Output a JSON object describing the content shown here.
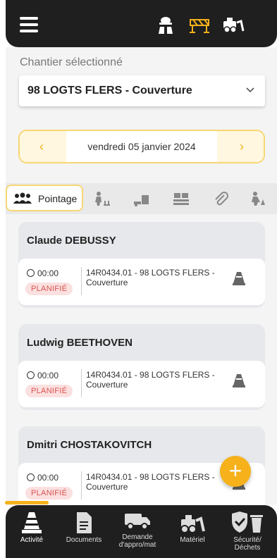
{
  "header": {
    "icons": [
      "worker-icon",
      "barrier-icon",
      "machinery-icon"
    ]
  },
  "site": {
    "label": "Chantier sélectionné",
    "selected": "98 LOGTS FLERS - Couverture"
  },
  "date": {
    "prev": "‹",
    "next": "›",
    "value": "vendredi 05 janvier 2024"
  },
  "tabs": {
    "active_label": "Pointage",
    "items": [
      "team-icon",
      "worker-move-icon",
      "delivery-icon",
      "pallet-icon",
      "paperclip-icon",
      "site-worker-icon"
    ]
  },
  "cards": [
    {
      "name": "Claude DEBUSSY",
      "time": "00:00",
      "status": "PLANIFIÉ",
      "description": "14R0434.01 - 98 LOGTS FLERS - Couverture"
    },
    {
      "name": "Ludwig BEETHOVEN",
      "time": "00:00",
      "status": "PLANIFIÉ",
      "description": "14R0434.01 - 98 LOGTS FLERS - Couverture"
    },
    {
      "name": "Dmitri CHOSTAKOVITCH",
      "time": "00:00",
      "status": "PLANIFIÉ",
      "description": "14R0434.01 - 98 LOGTS FLERS - Couverture"
    }
  ],
  "fab": {
    "label": "+"
  },
  "bottom_nav": [
    {
      "label": "Activité",
      "icon": "cone-icon",
      "active": true
    },
    {
      "label": "Documents",
      "icon": "document-icon"
    },
    {
      "label": "Demande d'appro/mat",
      "icon": "truck-icon"
    },
    {
      "label": "Matériel",
      "icon": "machinery-icon"
    },
    {
      "label": "Sécurité/ Déchets",
      "icon": "shield-bin-icon"
    }
  ],
  "colors": {
    "accent": "#f6b11b",
    "dark": "#1f1f1f",
    "badge": "#d9534f"
  }
}
